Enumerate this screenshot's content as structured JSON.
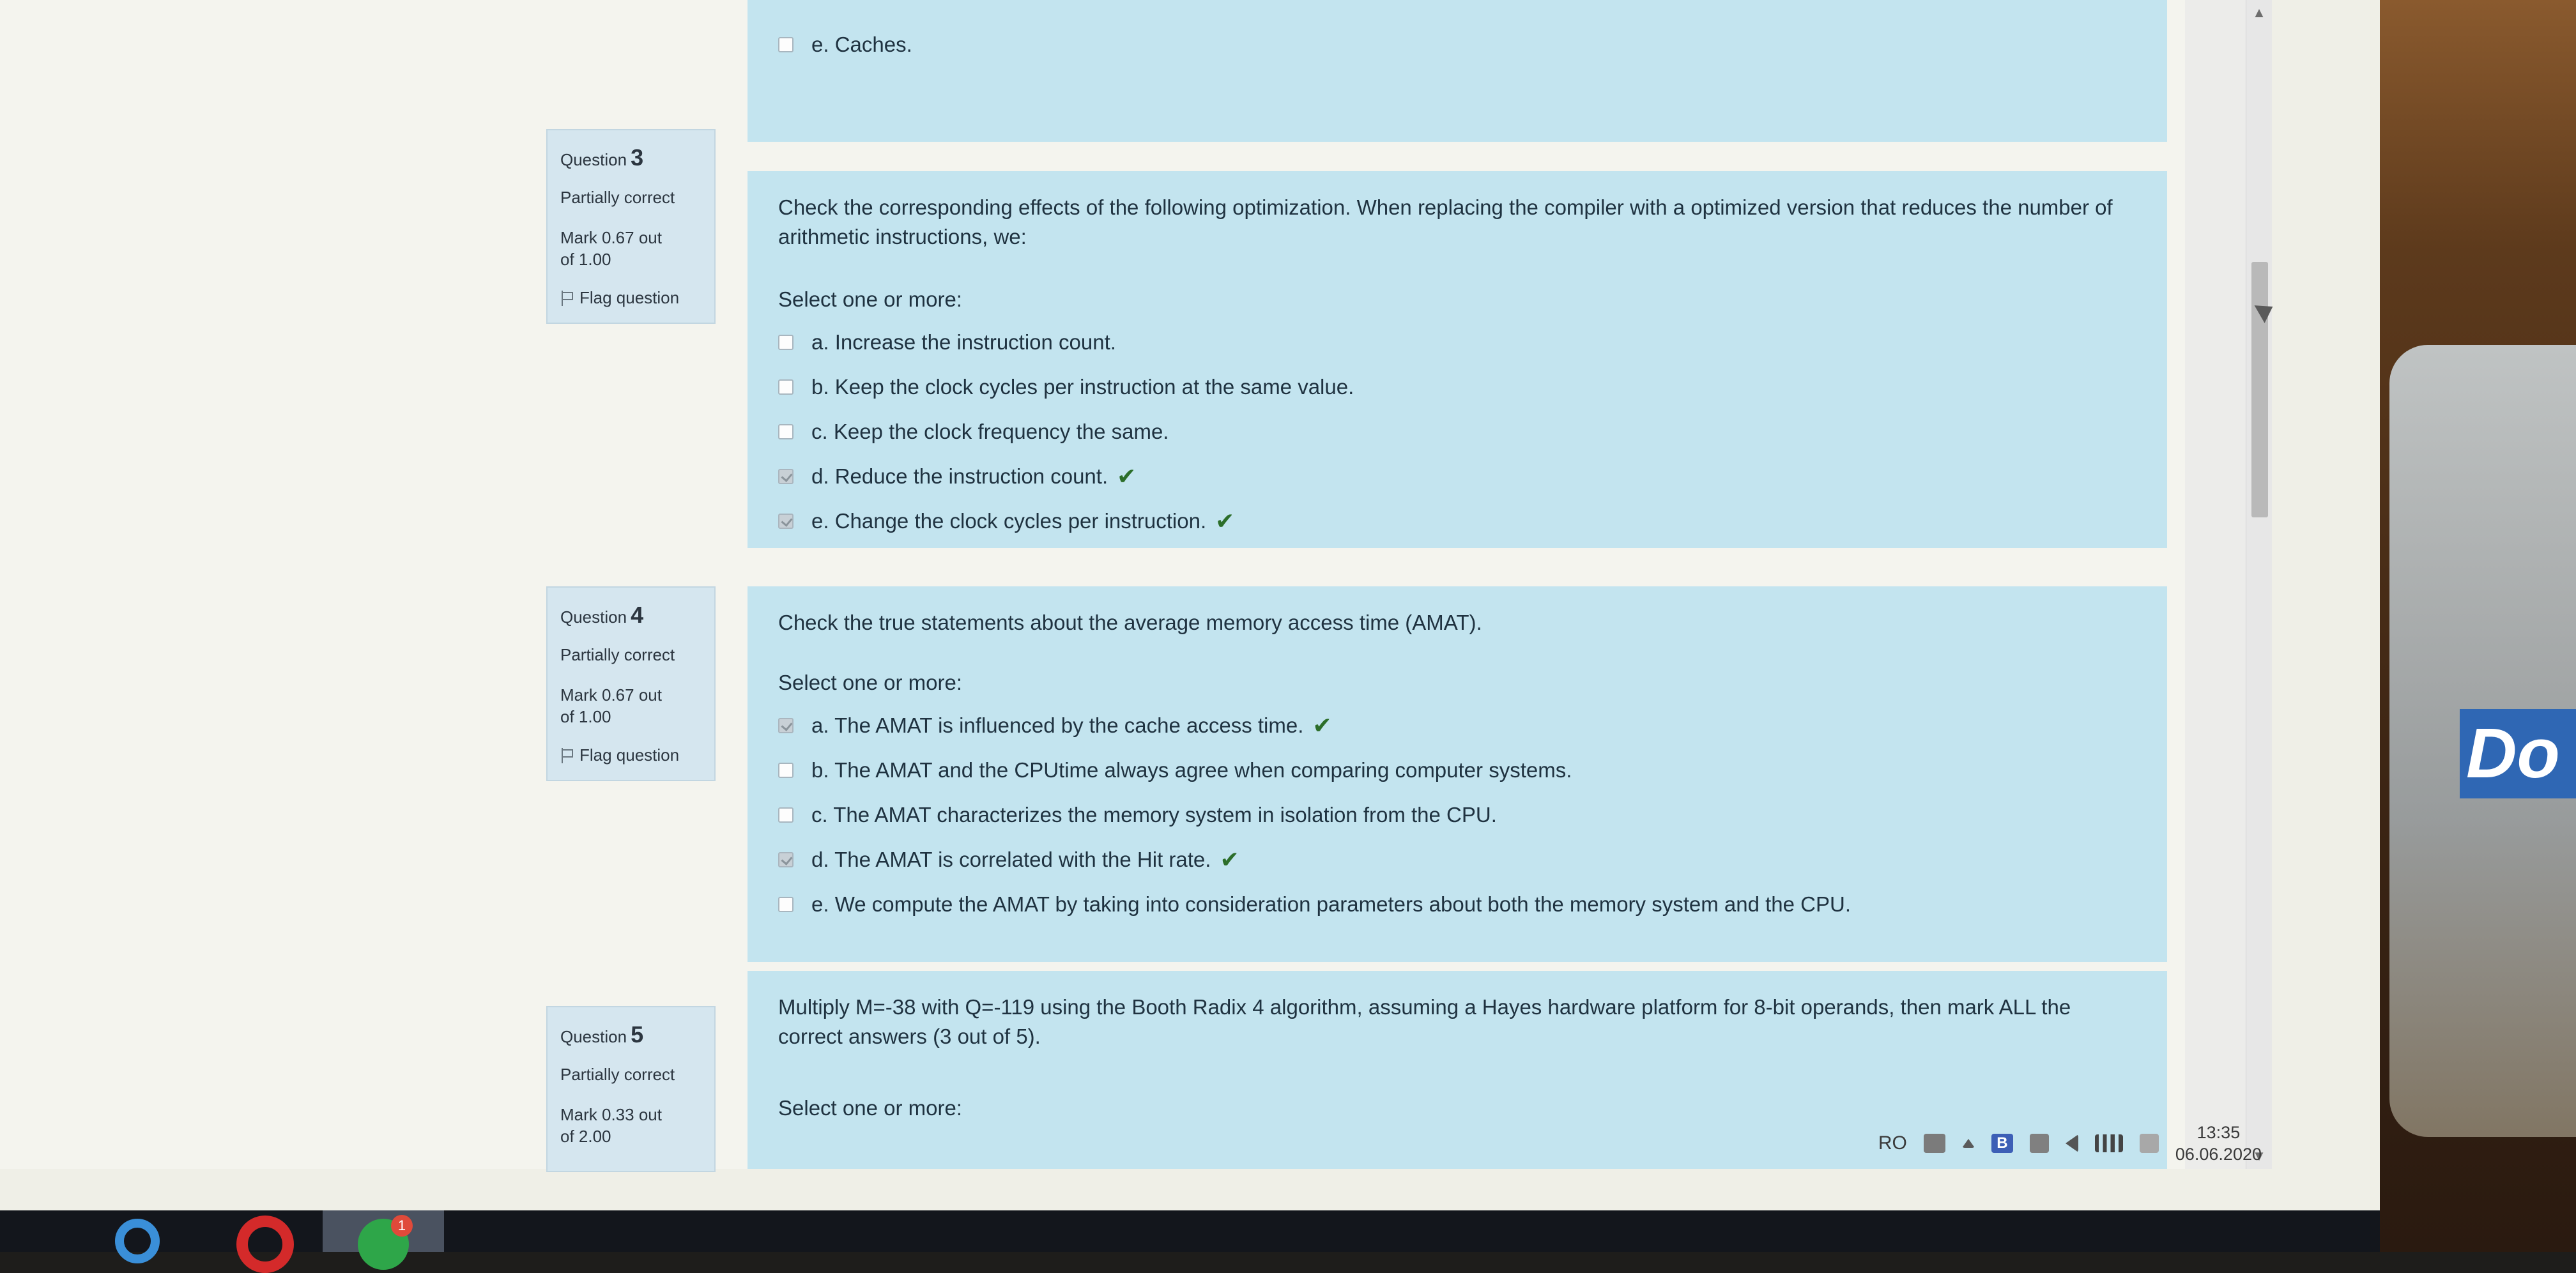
{
  "prev_question": {
    "tail_option": {
      "label": "e. Caches.",
      "checked": false
    }
  },
  "questions": [
    {
      "word": "Question",
      "number": "3",
      "state": "Partially correct",
      "mark_line1": "Mark 0.67 out",
      "mark_line2": "of 1.00",
      "flag": "Flag question",
      "text": "Check the corresponding effects of the following optimization. When replacing the compiler with a optimized version that reduces the number of arithmetic instructions, we:",
      "prompt": "Select one or more:",
      "options": [
        {
          "label": "a. Increase the instruction count.",
          "checked": false,
          "correct": false
        },
        {
          "label": "b. Keep the clock cycles per instruction at the same value.",
          "checked": false,
          "correct": false
        },
        {
          "label": "c. Keep the clock frequency the same.",
          "checked": false,
          "correct": false
        },
        {
          "label": "d. Reduce the instruction count.",
          "checked": true,
          "correct": true
        },
        {
          "label": "e. Change the clock cycles per instruction.",
          "checked": true,
          "correct": true
        }
      ]
    },
    {
      "word": "Question",
      "number": "4",
      "state": "Partially correct",
      "mark_line1": "Mark 0.67 out",
      "mark_line2": "of 1.00",
      "flag": "Flag question",
      "text": "Check the true statements about the average memory access time (AMAT).",
      "prompt": "Select one or more:",
      "options": [
        {
          "label": "a. The AMAT is influenced by the cache access time.",
          "checked": true,
          "correct": true
        },
        {
          "label": "b. The AMAT and the CPUtime always agree when comparing computer systems.",
          "checked": false,
          "correct": false
        },
        {
          "label": "c. The AMAT characterizes the memory system in isolation from the CPU.",
          "checked": false,
          "correct": false
        },
        {
          "label": "d. The AMAT is correlated with the Hit rate.",
          "checked": true,
          "correct": true
        },
        {
          "label": "e. We compute the AMAT by taking into consideration parameters about both the memory system and the CPU.",
          "checked": false,
          "correct": false
        }
      ]
    },
    {
      "word": "Question",
      "number": "5",
      "state": "Partially correct",
      "mark_line1": "Mark 0.33 out",
      "mark_line2": "of 2.00",
      "text": "Multiply M=-38 with Q=-119 using the Booth Radix 4 algorithm, assuming a Hayes hardware platform for 8-bit operands, then mark ALL the correct answers (3 out of 5).",
      "prompt": "Select one or more:"
    }
  ],
  "tray": {
    "lang": "RO",
    "time": "13:35",
    "date": "06.06.2020",
    "b_icon": "B"
  },
  "taskbar": {
    "whatsapp_badge": "1"
  },
  "glass_label": "Do",
  "tick_glyph": "✔",
  "icons": [
    "flag-icon",
    "scroll-up-icon",
    "scroll-down-icon",
    "internet-explorer-icon",
    "opera-icon",
    "whatsapp-icon",
    "keyboard-icon",
    "network-icon",
    "volume-icon",
    "signal-icon",
    "action-center-icon"
  ]
}
